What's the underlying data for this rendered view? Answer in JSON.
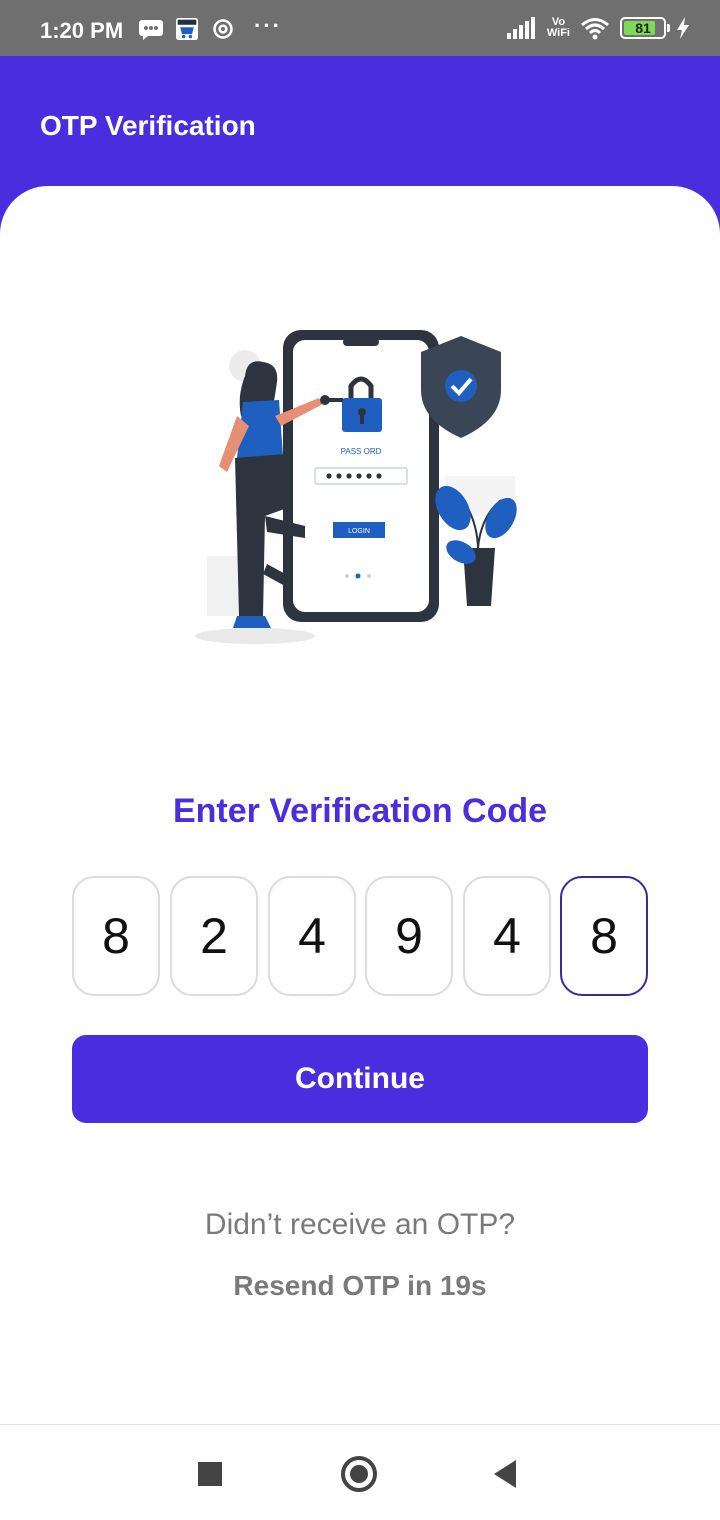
{
  "status_bar": {
    "time": "1:20 PM",
    "vowifi_top": "Vo",
    "vowifi_bottom": "WiFi",
    "battery_level": "81",
    "battery_percent": 81,
    "icons_left": [
      "message-icon",
      "amazon-shopping-icon",
      "at-sign-icon",
      "more-dots-icon"
    ],
    "icons_right": [
      "signal-icon",
      "vowifi-icon",
      "wifi-icon",
      "battery-icon",
      "charging-icon"
    ]
  },
  "app_bar": {
    "title": "OTP Verification"
  },
  "illustration": {
    "password_label": "PASS ORD",
    "login_label": "LOGIN"
  },
  "main": {
    "heading": "Enter Verification Code",
    "otp_digits": [
      "8",
      "2",
      "4",
      "9",
      "4",
      "8"
    ],
    "continue_label": "Continue",
    "resend_question": "Didn’t receive an OTP?",
    "resend_timer": "Resend OTP in 19s"
  },
  "colors": {
    "primary": "#4a2ddf",
    "status_bar": "#6f6f6f",
    "muted_text": "#7a7a7a",
    "otp_border": "#dcdcdc",
    "otp_active_border": "#3a2a9c"
  },
  "nav_bar": {
    "icons": [
      "recents-square-icon",
      "home-circle-icon",
      "back-triangle-icon"
    ]
  }
}
